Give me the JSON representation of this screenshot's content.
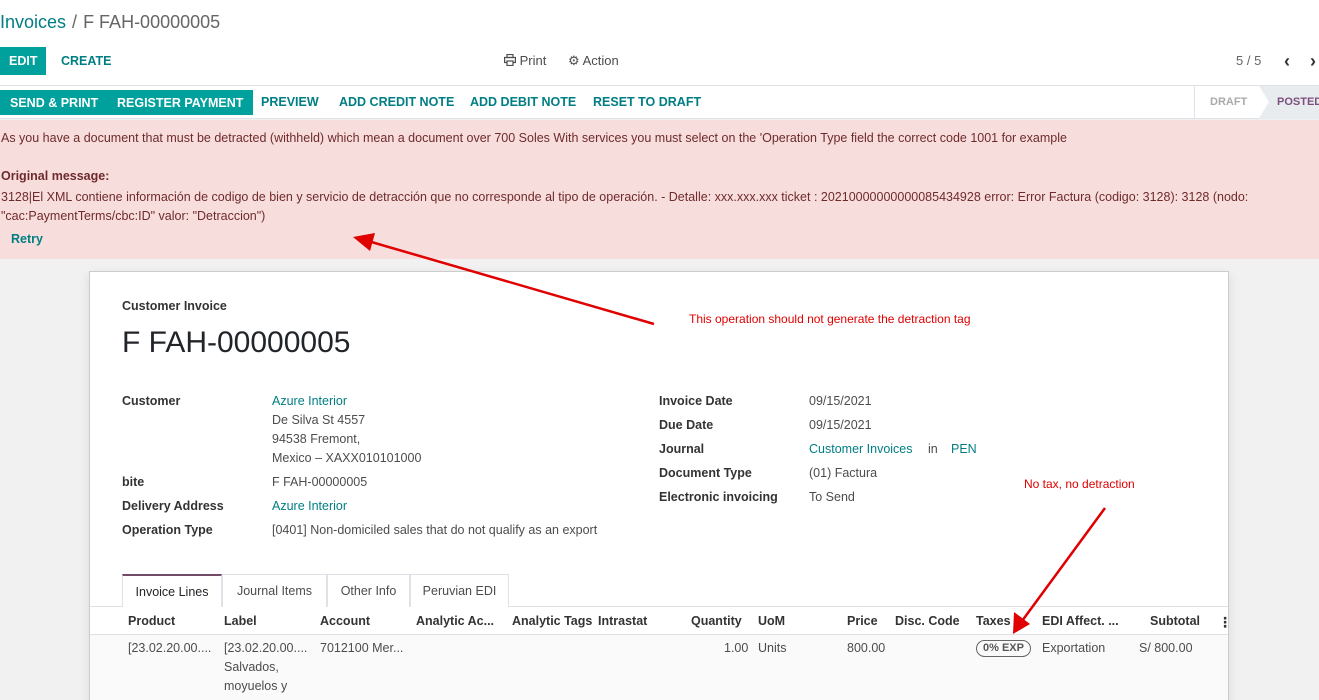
{
  "breadcrumb": {
    "parent": "Invoices",
    "separator": "/",
    "current": "F FAH-00000005"
  },
  "toolbar": {
    "edit": "EDIT",
    "create": "CREATE",
    "print": "Print",
    "action": "Action",
    "pager": "5 / 5"
  },
  "statusbar": {
    "buttons": [
      "SEND & PRINT",
      "REGISTER PAYMENT",
      "PREVIEW",
      "ADD CREDIT NOTE",
      "ADD DEBIT NOTE",
      "RESET TO DRAFT"
    ],
    "stages": [
      "DRAFT",
      "POSTED"
    ],
    "active_stage": "POSTED"
  },
  "alert": {
    "message": "As you have a document that must be detracted (withheld) which mean a document over 700 Soles With services you must select on the 'Operation Type field the correct code 1001 for example",
    "original_title": "Original message:",
    "original_body": "3128|El XML contiene información de codigo de bien y servicio de detracción que no corresponde al tipo de operación. - Detalle: xxx.xxx.xxx ticket : 20210000000000085434928 error: Error Factura (codigo: 3128): 3128 (nodo: \"cac:PaymentTerms/cbc:ID\" valor: \"Detraccion\")",
    "retry": "Retry"
  },
  "invoice": {
    "type": "Customer Invoice",
    "name": "F FAH-00000005",
    "left_fields": {
      "customer_label": "Customer",
      "customer_name": "Azure Interior",
      "address_line1": "De Silva St 4557",
      "address_line2": "94538 Fremont,",
      "address_line3": "Mexico – XAXX010101000",
      "bite_label": "bite",
      "bite_value": "F FAH-00000005",
      "delivery_label": "Delivery Address",
      "delivery_value": "Azure Interior",
      "operation_label": "Operation Type",
      "operation_value": "[0401] Non-domiciled sales that do not qualify as an export"
    },
    "right_fields": {
      "invoice_date_label": "Invoice Date",
      "invoice_date": "09/15/2021",
      "due_date_label": "Due Date",
      "due_date": "09/15/2021",
      "journal_label": "Journal",
      "journal": "Customer Invoices",
      "journal_in": "in",
      "currency": "PEN",
      "doc_type_label": "Document Type",
      "doc_type": "(01) Factura",
      "einvoice_label": "Electronic invoicing",
      "einvoice": "To Send"
    }
  },
  "tabs": [
    "Invoice Lines",
    "Journal Items",
    "Other Info",
    "Peruvian EDI"
  ],
  "lines_table": {
    "headers": [
      "Product",
      "Label",
      "Account",
      "Analytic Ac...",
      "Analytic Tags",
      "Intrastat",
      "Quantity",
      "UoM",
      "Price",
      "Disc. Code",
      "Taxes",
      "EDI Affect. ...",
      "Subtotal"
    ],
    "row": {
      "product": "[23.02.20.00....",
      "label_l1": "[23.02.20.00....",
      "label_l2": "Salvados,",
      "label_l3": "moyuelos y",
      "account": "7012100 Mer...",
      "quantity": "1.00",
      "uom": "Units",
      "price": "800.00",
      "tax": "0% EXP",
      "edi_affect": "Exportation",
      "subtotal": "S/ 800.00"
    }
  },
  "annotations": {
    "top": "This operation should not generate the detraction tag",
    "bottom": "No tax, no detraction",
    "color": "#e00000"
  }
}
